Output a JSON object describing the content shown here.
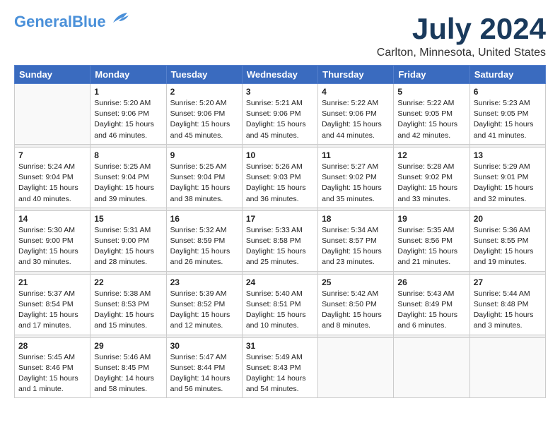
{
  "header": {
    "logo_general": "General",
    "logo_blue": "Blue",
    "title": "July 2024",
    "subtitle": "Carlton, Minnesota, United States"
  },
  "weekdays": [
    "Sunday",
    "Monday",
    "Tuesday",
    "Wednesday",
    "Thursday",
    "Friday",
    "Saturday"
  ],
  "weeks": [
    [
      {
        "day": "",
        "sunrise": "",
        "sunset": "",
        "daylight": ""
      },
      {
        "day": "1",
        "sunrise": "Sunrise: 5:20 AM",
        "sunset": "Sunset: 9:06 PM",
        "daylight": "Daylight: 15 hours and 46 minutes."
      },
      {
        "day": "2",
        "sunrise": "Sunrise: 5:20 AM",
        "sunset": "Sunset: 9:06 PM",
        "daylight": "Daylight: 15 hours and 45 minutes."
      },
      {
        "day": "3",
        "sunrise": "Sunrise: 5:21 AM",
        "sunset": "Sunset: 9:06 PM",
        "daylight": "Daylight: 15 hours and 45 minutes."
      },
      {
        "day": "4",
        "sunrise": "Sunrise: 5:22 AM",
        "sunset": "Sunset: 9:06 PM",
        "daylight": "Daylight: 15 hours and 44 minutes."
      },
      {
        "day": "5",
        "sunrise": "Sunrise: 5:22 AM",
        "sunset": "Sunset: 9:05 PM",
        "daylight": "Daylight: 15 hours and 42 minutes."
      },
      {
        "day": "6",
        "sunrise": "Sunrise: 5:23 AM",
        "sunset": "Sunset: 9:05 PM",
        "daylight": "Daylight: 15 hours and 41 minutes."
      }
    ],
    [
      {
        "day": "7",
        "sunrise": "Sunrise: 5:24 AM",
        "sunset": "Sunset: 9:04 PM",
        "daylight": "Daylight: 15 hours and 40 minutes."
      },
      {
        "day": "8",
        "sunrise": "Sunrise: 5:25 AM",
        "sunset": "Sunset: 9:04 PM",
        "daylight": "Daylight: 15 hours and 39 minutes."
      },
      {
        "day": "9",
        "sunrise": "Sunrise: 5:25 AM",
        "sunset": "Sunset: 9:04 PM",
        "daylight": "Daylight: 15 hours and 38 minutes."
      },
      {
        "day": "10",
        "sunrise": "Sunrise: 5:26 AM",
        "sunset": "Sunset: 9:03 PM",
        "daylight": "Daylight: 15 hours and 36 minutes."
      },
      {
        "day": "11",
        "sunrise": "Sunrise: 5:27 AM",
        "sunset": "Sunset: 9:02 PM",
        "daylight": "Daylight: 15 hours and 35 minutes."
      },
      {
        "day": "12",
        "sunrise": "Sunrise: 5:28 AM",
        "sunset": "Sunset: 9:02 PM",
        "daylight": "Daylight: 15 hours and 33 minutes."
      },
      {
        "day": "13",
        "sunrise": "Sunrise: 5:29 AM",
        "sunset": "Sunset: 9:01 PM",
        "daylight": "Daylight: 15 hours and 32 minutes."
      }
    ],
    [
      {
        "day": "14",
        "sunrise": "Sunrise: 5:30 AM",
        "sunset": "Sunset: 9:00 PM",
        "daylight": "Daylight: 15 hours and 30 minutes."
      },
      {
        "day": "15",
        "sunrise": "Sunrise: 5:31 AM",
        "sunset": "Sunset: 9:00 PM",
        "daylight": "Daylight: 15 hours and 28 minutes."
      },
      {
        "day": "16",
        "sunrise": "Sunrise: 5:32 AM",
        "sunset": "Sunset: 8:59 PM",
        "daylight": "Daylight: 15 hours and 26 minutes."
      },
      {
        "day": "17",
        "sunrise": "Sunrise: 5:33 AM",
        "sunset": "Sunset: 8:58 PM",
        "daylight": "Daylight: 15 hours and 25 minutes."
      },
      {
        "day": "18",
        "sunrise": "Sunrise: 5:34 AM",
        "sunset": "Sunset: 8:57 PM",
        "daylight": "Daylight: 15 hours and 23 minutes."
      },
      {
        "day": "19",
        "sunrise": "Sunrise: 5:35 AM",
        "sunset": "Sunset: 8:56 PM",
        "daylight": "Daylight: 15 hours and 21 minutes."
      },
      {
        "day": "20",
        "sunrise": "Sunrise: 5:36 AM",
        "sunset": "Sunset: 8:55 PM",
        "daylight": "Daylight: 15 hours and 19 minutes."
      }
    ],
    [
      {
        "day": "21",
        "sunrise": "Sunrise: 5:37 AM",
        "sunset": "Sunset: 8:54 PM",
        "daylight": "Daylight: 15 hours and 17 minutes."
      },
      {
        "day": "22",
        "sunrise": "Sunrise: 5:38 AM",
        "sunset": "Sunset: 8:53 PM",
        "daylight": "Daylight: 15 hours and 15 minutes."
      },
      {
        "day": "23",
        "sunrise": "Sunrise: 5:39 AM",
        "sunset": "Sunset: 8:52 PM",
        "daylight": "Daylight: 15 hours and 12 minutes."
      },
      {
        "day": "24",
        "sunrise": "Sunrise: 5:40 AM",
        "sunset": "Sunset: 8:51 PM",
        "daylight": "Daylight: 15 hours and 10 minutes."
      },
      {
        "day": "25",
        "sunrise": "Sunrise: 5:42 AM",
        "sunset": "Sunset: 8:50 PM",
        "daylight": "Daylight: 15 hours and 8 minutes."
      },
      {
        "day": "26",
        "sunrise": "Sunrise: 5:43 AM",
        "sunset": "Sunset: 8:49 PM",
        "daylight": "Daylight: 15 hours and 6 minutes."
      },
      {
        "day": "27",
        "sunrise": "Sunrise: 5:44 AM",
        "sunset": "Sunset: 8:48 PM",
        "daylight": "Daylight: 15 hours and 3 minutes."
      }
    ],
    [
      {
        "day": "28",
        "sunrise": "Sunrise: 5:45 AM",
        "sunset": "Sunset: 8:46 PM",
        "daylight": "Daylight: 15 hours and 1 minute."
      },
      {
        "day": "29",
        "sunrise": "Sunrise: 5:46 AM",
        "sunset": "Sunset: 8:45 PM",
        "daylight": "Daylight: 14 hours and 58 minutes."
      },
      {
        "day": "30",
        "sunrise": "Sunrise: 5:47 AM",
        "sunset": "Sunset: 8:44 PM",
        "daylight": "Daylight: 14 hours and 56 minutes."
      },
      {
        "day": "31",
        "sunrise": "Sunrise: 5:49 AM",
        "sunset": "Sunset: 8:43 PM",
        "daylight": "Daylight: 14 hours and 54 minutes."
      },
      {
        "day": "",
        "sunrise": "",
        "sunset": "",
        "daylight": ""
      },
      {
        "day": "",
        "sunrise": "",
        "sunset": "",
        "daylight": ""
      },
      {
        "day": "",
        "sunrise": "",
        "sunset": "",
        "daylight": ""
      }
    ]
  ]
}
